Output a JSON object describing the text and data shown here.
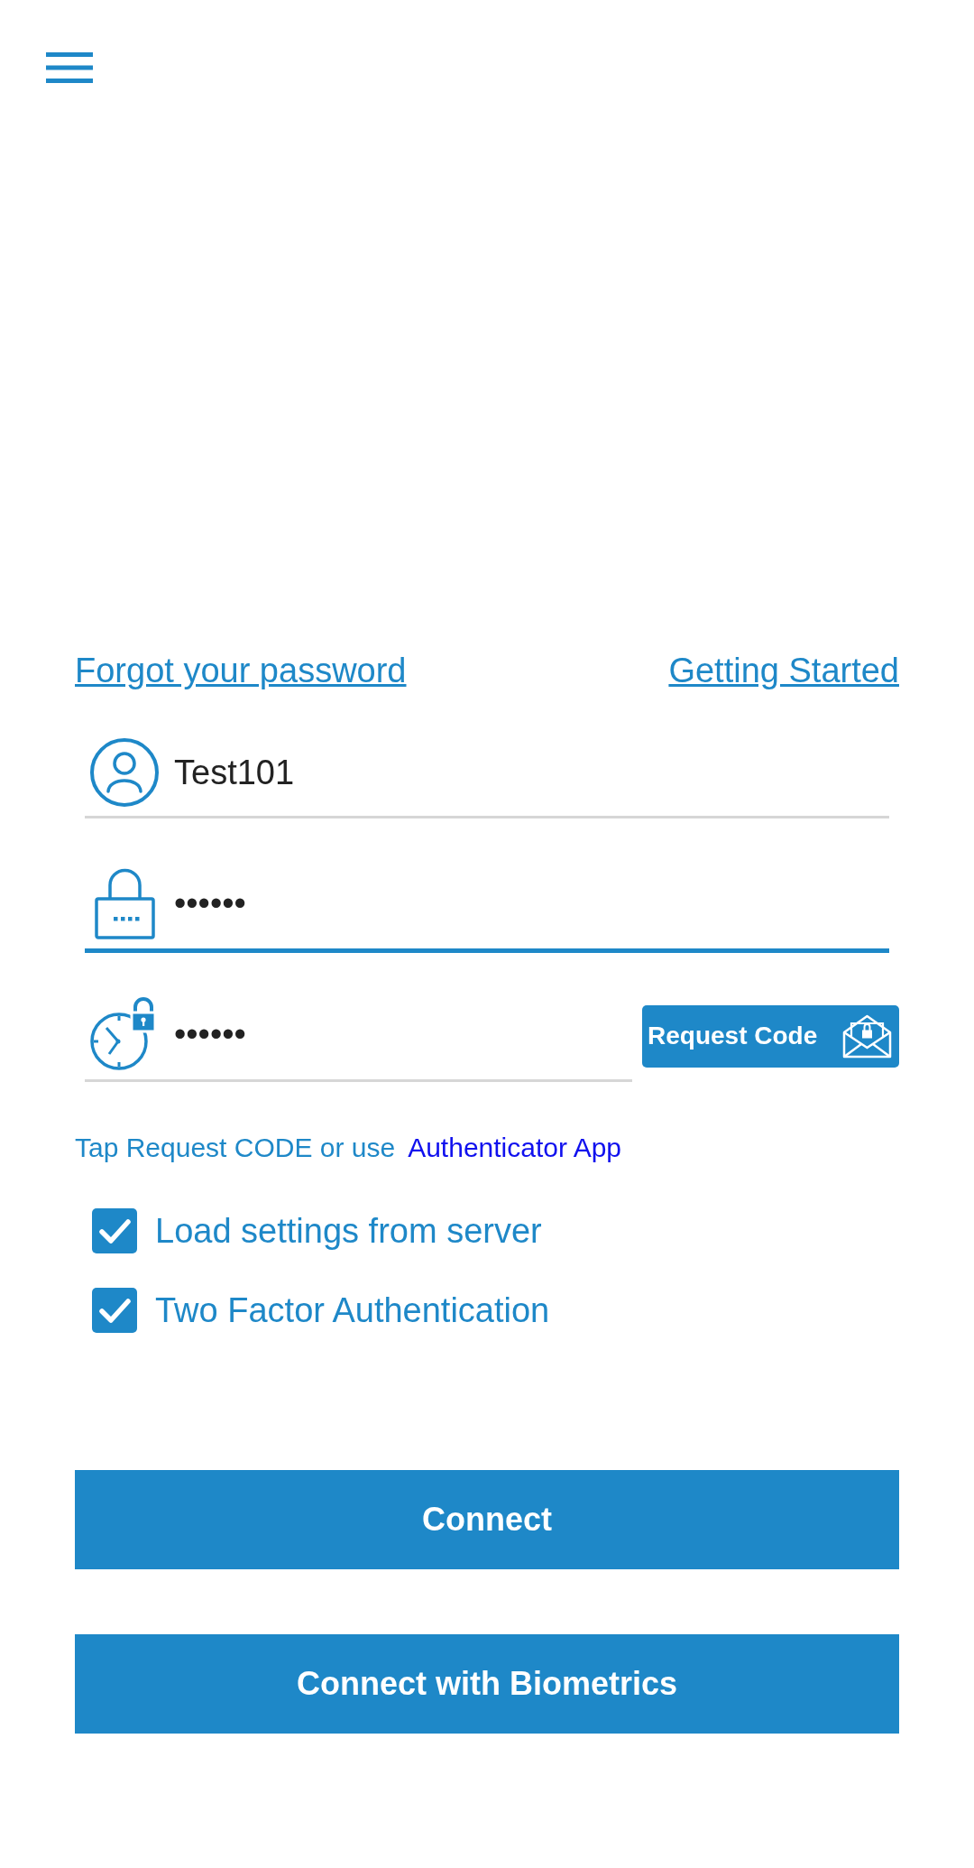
{
  "links": [
    {
      "label": "Forgot your password"
    },
    {
      "label": "Getting Started"
    }
  ],
  "fields": [
    {
      "kind": "username",
      "value": "Test101",
      "focused": false
    },
    {
      "kind": "password",
      "value": "••••••",
      "focused": true
    },
    {
      "kind": "code",
      "value": "••••••",
      "focused": false,
      "button": {
        "label": "Request Code"
      }
    }
  ],
  "hint": {
    "text": "Tap Request CODE or use",
    "link": "Authenticator App"
  },
  "options": [
    {
      "label": "Load settings from server",
      "checked": true
    },
    {
      "label": "Two Factor Authentication",
      "checked": true
    }
  ],
  "buttons": [
    {
      "label": "Connect"
    },
    {
      "label": "Connect with Biometrics"
    }
  ]
}
